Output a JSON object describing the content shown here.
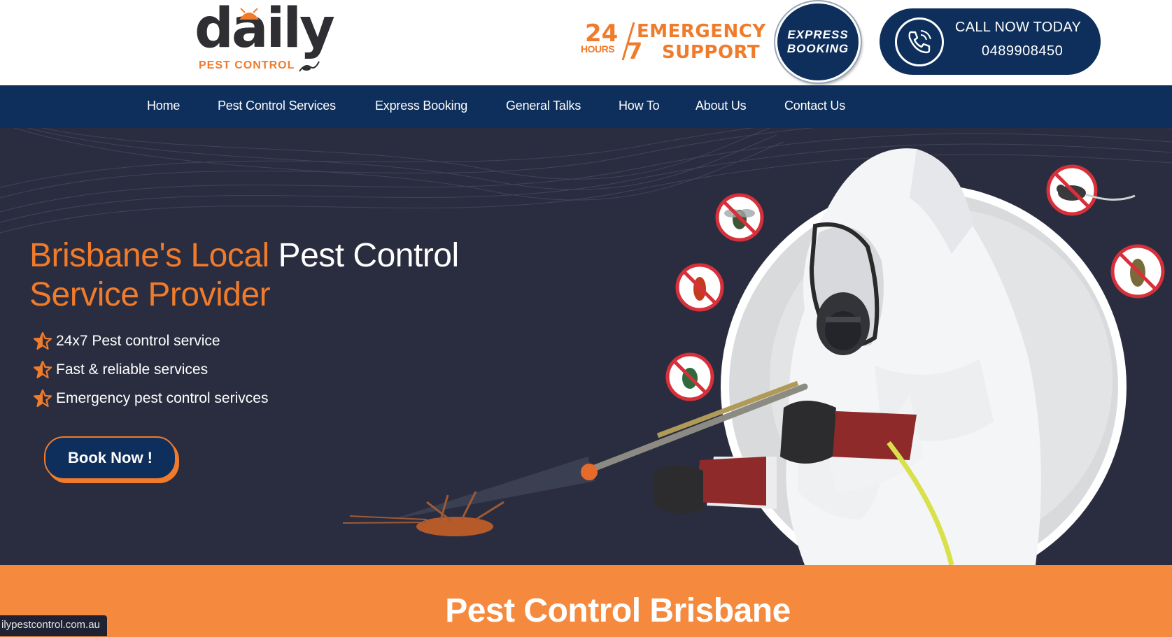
{
  "header": {
    "logo": {
      "word": "daily",
      "subtitle": "PEST CONTROL",
      "icon": "bug-logo-icon"
    },
    "emergency": {
      "big_number": "24",
      "hours": "HOURS",
      "seven": "7",
      "line1": "EMERGENCY",
      "line2": "SUPPORT"
    },
    "express": {
      "line1": "EXPRESS",
      "line2": "BOOKING"
    },
    "call": {
      "label": "CALL NOW TODAY",
      "number": "0489908450",
      "icon": "phone-icon"
    }
  },
  "nav": {
    "items": [
      {
        "label": "Home"
      },
      {
        "label": "Pest Control Services"
      },
      {
        "label": "Express Booking"
      },
      {
        "label": "General Talks"
      },
      {
        "label": "How To"
      },
      {
        "label": "About Us"
      },
      {
        "label": "Contact Us"
      }
    ]
  },
  "hero": {
    "title_orange_1": "Brisbane's Local",
    "title_white": "Pest Control",
    "title_orange_2": "Service Provider",
    "features": [
      "24x7 Pest control service",
      "Fast & reliable services",
      "Emergency pest control serivces"
    ],
    "book_button": "Book Now !"
  },
  "band": {
    "title": "Pest Control Brisbane"
  },
  "status": {
    "url": "ilypestcontrol.com.au"
  },
  "colors": {
    "navy": "#0e2f5c",
    "orange": "#f07b2b",
    "hero_bg": "#2a2d3f",
    "band": "#f58a3f"
  }
}
